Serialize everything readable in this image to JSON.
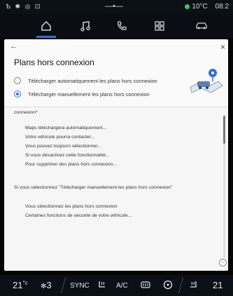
{
  "status": {
    "left_icons": "Ѣ ✱ ◎ ⊡",
    "page_indicator": "—•—",
    "temperature": "10°C",
    "time": "08:2"
  },
  "nav": {
    "tabs": [
      {
        "name": "home-icon",
        "active": true
      },
      {
        "name": "music-icon",
        "active": false
      },
      {
        "name": "phone-icon",
        "active": false
      },
      {
        "name": "apps-icon",
        "active": false
      },
      {
        "name": "car-icon",
        "active": false
      }
    ],
    "accent": "#2f6fd6"
  },
  "panel": {
    "back_glyph": "←",
    "close_glyph": "×",
    "title": "Plans hors connexion",
    "options": [
      {
        "label": "Télécharger automatiquement les plans hors connexion",
        "selected": false
      },
      {
        "label": "Télécharger manuellement les plans hors connexion",
        "selected": true
      }
    ]
  },
  "content": {
    "heading1": "connexion*",
    "list1": [
      "Maps téléchargera automatiquement...",
      "Votre véhicule pourra contacter...",
      "Vous pouvez toujours sélectionner...",
      "Si vous désactivez cette fonctionnalité...",
      "Pour supprimer des plans hors connexion..."
    ],
    "heading2": "Si vous sélectionnez \"Télécharger manuellement les plans hors connexion\"",
    "list2": [
      "Vous sélectionnez les plans hors connexion",
      "Certaines fonctions de sécurité de votre véhicule..."
    ]
  },
  "climate": {
    "left_temp": "21",
    "left_temp_unit": "°c",
    "fan_level": "3",
    "sync": "SYNC",
    "ac": "A/C",
    "right_temp": "21"
  }
}
